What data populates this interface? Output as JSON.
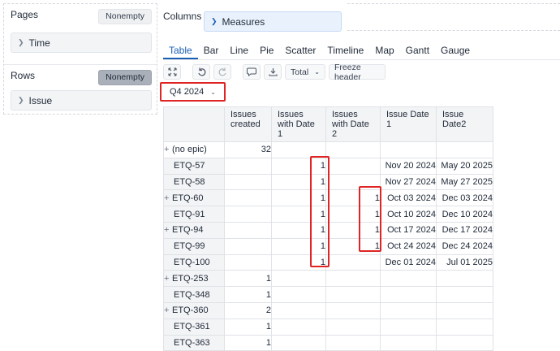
{
  "pages": {
    "title": "Pages",
    "nonempty": "Nonempty",
    "dimension": "Time"
  },
  "rows": {
    "title": "Rows",
    "nonempty": "Nonempty",
    "dimension": "Issue"
  },
  "columns": {
    "title": "Columns",
    "dimension": "Measures"
  },
  "tabs": [
    "Table",
    "Bar",
    "Line",
    "Pie",
    "Scatter",
    "Timeline",
    "Map",
    "Gantt",
    "Gauge"
  ],
  "toolbar": {
    "total_label": "Total",
    "freeze_label": "Freeze header"
  },
  "period": "Q4 2024",
  "table": {
    "headers": [
      "Issues created",
      "Issues with Date 1",
      "Issues with Date 2",
      "Issue Date 1",
      "Issue Date2"
    ],
    "rows": [
      {
        "label": "(no epic)",
        "expandable": true,
        "cells": [
          "32",
          "",
          "",
          "",
          ""
        ]
      },
      {
        "label": "ETQ-57",
        "expandable": false,
        "cells": [
          "",
          "1",
          "",
          "Nov 20 2024",
          "May 20 2025"
        ]
      },
      {
        "label": "ETQ-58",
        "expandable": false,
        "cells": [
          "",
          "1",
          "",
          "Nov 27 2024",
          "May 27 2025"
        ]
      },
      {
        "label": "ETQ-60",
        "expandable": true,
        "cells": [
          "",
          "1",
          "1",
          "Oct 03 2024",
          "Dec 03 2024"
        ]
      },
      {
        "label": "ETQ-91",
        "expandable": false,
        "cells": [
          "",
          "1",
          "1",
          "Oct 10 2024",
          "Dec 10 2024"
        ]
      },
      {
        "label": "ETQ-94",
        "expandable": true,
        "cells": [
          "",
          "1",
          "1",
          "Oct 17 2024",
          "Dec 17 2024"
        ]
      },
      {
        "label": "ETQ-99",
        "expandable": false,
        "cells": [
          "",
          "1",
          "1",
          "Oct 24 2024",
          "Dec 24 2024"
        ]
      },
      {
        "label": "ETQ-100",
        "expandable": false,
        "cells": [
          "",
          "1",
          "",
          "Dec 01 2024",
          "Jul 01 2025"
        ]
      },
      {
        "label": "ETQ-253",
        "expandable": true,
        "cells": [
          "1",
          "",
          "",
          "",
          ""
        ]
      },
      {
        "label": "ETQ-348",
        "expandable": false,
        "cells": [
          "1",
          "",
          "",
          "",
          ""
        ]
      },
      {
        "label": "ETQ-360",
        "expandable": true,
        "cells": [
          "2",
          "",
          "",
          "",
          ""
        ]
      },
      {
        "label": "ETQ-361",
        "expandable": false,
        "cells": [
          "1",
          "",
          "",
          "",
          ""
        ]
      },
      {
        "label": "ETQ-363",
        "expandable": false,
        "cells": [
          "1",
          "",
          "",
          "",
          ""
        ]
      }
    ]
  },
  "colors": {
    "accent": "#1a5fb4",
    "highlight": "#e02424",
    "header_bg": "#f3f4f6",
    "measures_bg": "#e8f1fc"
  }
}
